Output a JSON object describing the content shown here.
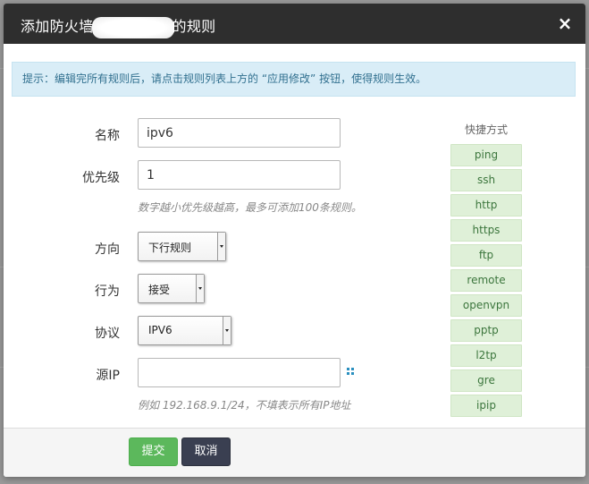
{
  "dialog": {
    "title_prefix": "添加防火墙",
    "title_suffix": "的规则",
    "close_label": "×"
  },
  "notice": {
    "text": "提示：编辑完所有规则后，请点击规则列表上方的 “应用修改” 按钮，使得规则生效。"
  },
  "form": {
    "name": {
      "label": "名称",
      "value": "ipv6"
    },
    "priority": {
      "label": "优先级",
      "value": "1",
      "hint": "数字越小优先级越高，最多可添加100条规则。"
    },
    "direction": {
      "label": "方向",
      "selected": "下行规则"
    },
    "action": {
      "label": "行为",
      "selected": "接受"
    },
    "protocol": {
      "label": "协议",
      "selected": "IPV6"
    },
    "source_ip": {
      "label": "源IP",
      "value": "",
      "hint": "例如 192.168.9.1/24，不填表示所有IP地址"
    }
  },
  "shortcuts": {
    "title": "快捷方式",
    "items": [
      "ping",
      "ssh",
      "http",
      "https",
      "ftp",
      "remote",
      "openvpn",
      "pptp",
      "l2tp",
      "gre",
      "ipip"
    ]
  },
  "footer": {
    "submit_label": "提交",
    "cancel_label": "取消"
  },
  "colors": {
    "header_bg": "#2e2e2e",
    "notice_bg": "#d9edf7",
    "notice_text": "#31708f",
    "shortcut_bg": "#dff0d8",
    "shortcut_text": "#3c763d",
    "submit_bg": "#5cb85c",
    "cancel_bg": "#3a3f51"
  }
}
